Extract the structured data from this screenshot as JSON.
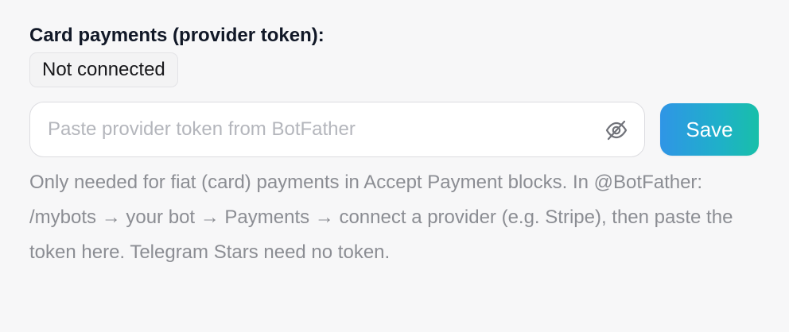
{
  "card_payments": {
    "label": "Card payments (provider token):",
    "status": "Not connected",
    "token_input": {
      "placeholder": "Paste provider token from BotFather",
      "value": ""
    },
    "visibility_icon": "eye-off-icon",
    "save_label": "Save",
    "help_text": "Only needed for fiat (card) payments in Accept Payment blocks. In @BotFather: /mybots → your bot → Payments → connect a provider (e.g. Stripe), then paste the token here. Telegram Stars need no token."
  },
  "colors": {
    "button_gradient_start": "#2f95e6",
    "button_gradient_end": "#18bfa9",
    "help_text": "#8b8d93",
    "label": "#111827"
  }
}
